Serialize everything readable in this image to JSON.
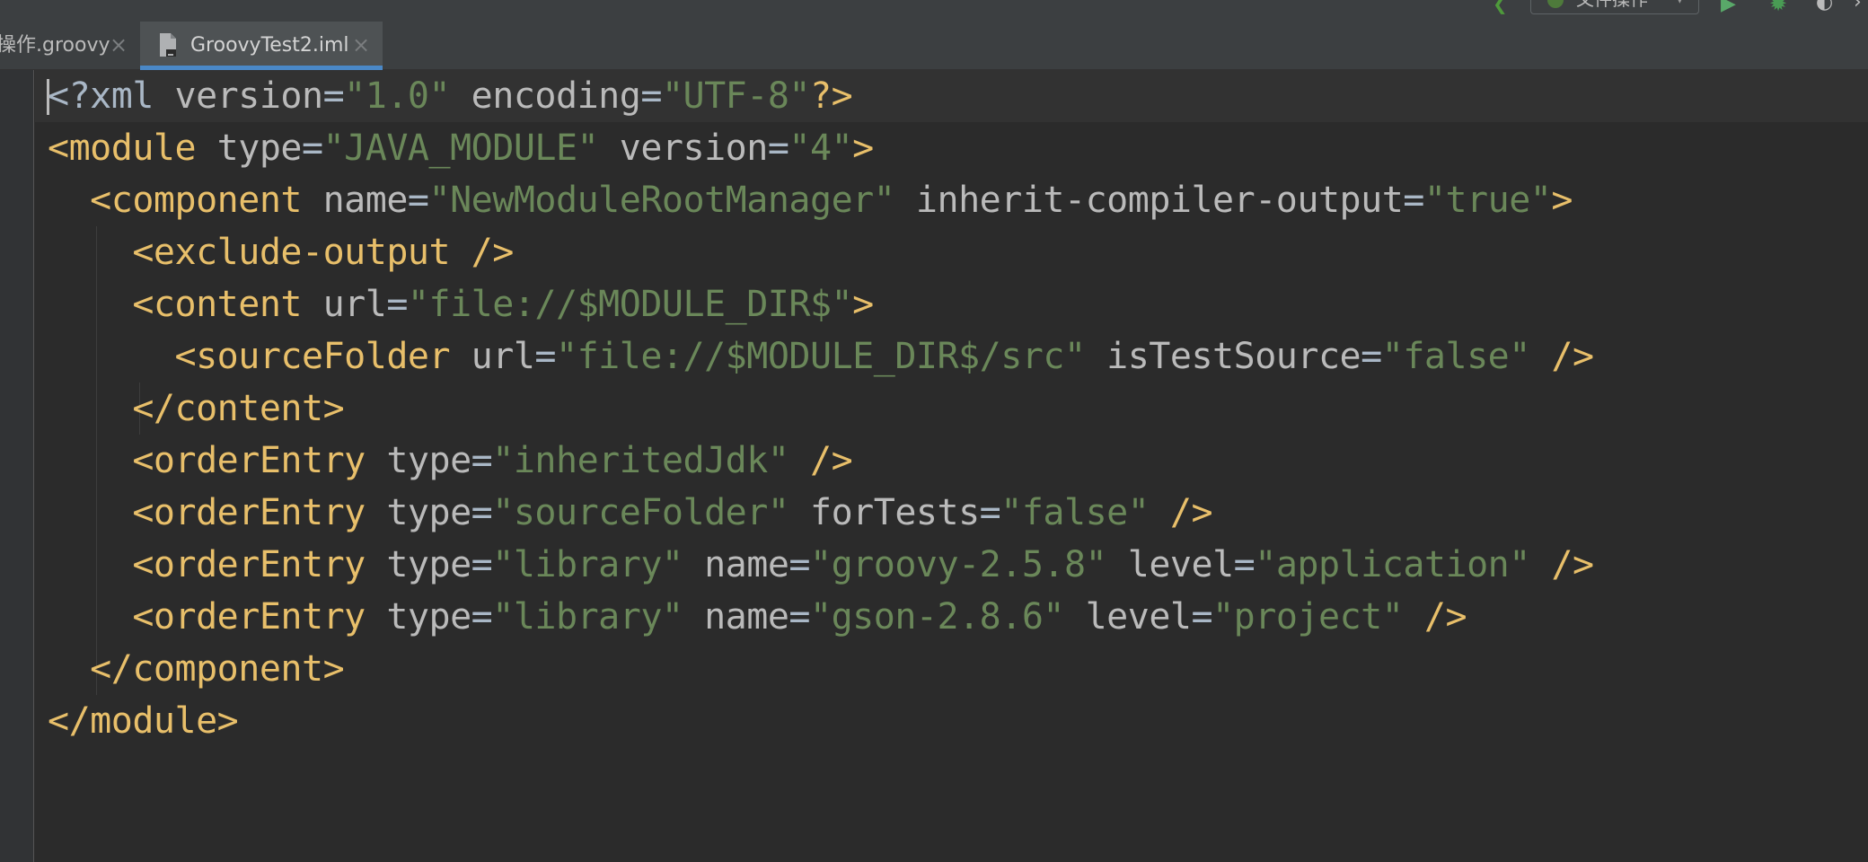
{
  "toolbar": {
    "run_config_label": "文件操作",
    "back_icon": "back-arrow-icon",
    "run_icon": "run-icon",
    "debug_icon": "debug-icon",
    "coverage_icon": "coverage-icon"
  },
  "tabs": [
    {
      "label": "操作.groovy",
      "active": false
    },
    {
      "label": "GroovyTest2.iml",
      "active": true
    }
  ],
  "colors": {
    "tag": "#e8bf6a",
    "attribute": "#bababa",
    "value": "#6a8759",
    "default_text": "#a9b7c6",
    "background": "#2b2b2b",
    "active_tab_underline": "#4a88c7"
  },
  "code_lines": [
    [
      "<?xml",
      " version",
      "=",
      "\"1.0\"",
      " encoding",
      "=",
      "\"UTF-8\"",
      "?>"
    ],
    [
      "<module",
      " type",
      "=",
      "\"JAVA_MODULE\"",
      " version",
      "=",
      "\"4\"",
      ">"
    ],
    [
      "  ",
      "<component",
      " name",
      "=",
      "\"NewModuleRootManager\"",
      " inherit-compiler-output",
      "=",
      "\"true\"",
      ">"
    ],
    [
      "    ",
      "<exclude-output",
      " />"
    ],
    [
      "    ",
      "<content",
      " url",
      "=",
      "\"file://$MODULE_DIR$\"",
      ">"
    ],
    [
      "      ",
      "<sourceFolder",
      " url",
      "=",
      "\"file://$MODULE_DIR$/src\"",
      " isTestSource",
      "=",
      "\"false\"",
      " />"
    ],
    [
      "    ",
      "</content>"
    ],
    [
      "    ",
      "<orderEntry",
      " type",
      "=",
      "\"inheritedJdk\"",
      " />"
    ],
    [
      "    ",
      "<orderEntry",
      " type",
      "=",
      "\"sourceFolder\"",
      " forTests",
      "=",
      "\"false\"",
      " />"
    ],
    [
      "    ",
      "<orderEntry",
      " type",
      "=",
      "\"library\"",
      " name",
      "=",
      "\"groovy-2.5.8\"",
      " level",
      "=",
      "\"application\"",
      " />"
    ],
    [
      "    ",
      "<orderEntry",
      " type",
      "=",
      "\"library\"",
      " name",
      "=",
      "\"gson-2.8.6\"",
      " level",
      "=",
      "\"project\"",
      " />"
    ],
    [
      "  ",
      "</component>"
    ],
    [
      "</module>"
    ]
  ]
}
